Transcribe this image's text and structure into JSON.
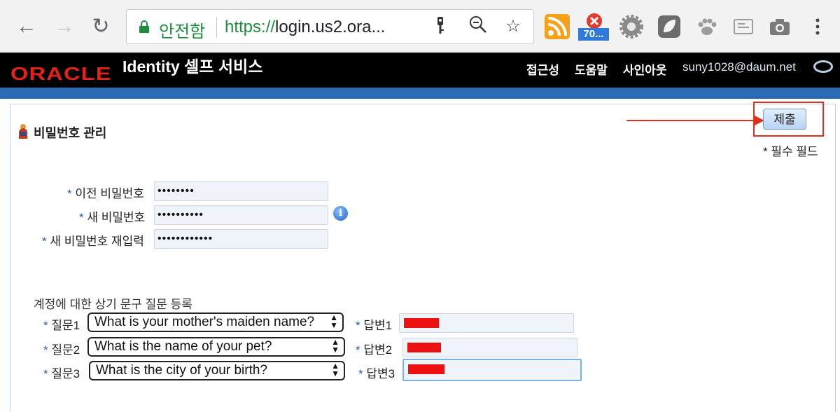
{
  "browser": {
    "secure_label": "안전함",
    "url_scheme": "https://",
    "url_rest": "login.us2.ora...",
    "notification_badge": "70..."
  },
  "header": {
    "logo": "ORACLE",
    "app_title": "Identity 셀프 서비스",
    "links": [
      "접근성",
      "도움말",
      "사인아웃"
    ],
    "user": "suny1028@daum.net"
  },
  "page": {
    "section_title": "비밀번호 관리",
    "submit_label": "제출",
    "required_note": "* 필수 필드"
  },
  "password": {
    "old_label": "이전 비밀번호",
    "old_value": "••••••••",
    "new_label": "새 비밀번호",
    "new_value": "••••••••••",
    "confirm_label": "새 비밀번호 재입력",
    "confirm_value": "••••••••••••",
    "star": "*"
  },
  "challenge": {
    "heading": "계정에 대한 상기 문구 질문 등록",
    "questions": [
      {
        "q_label": "질문1",
        "q_value": "What is your mother's maiden name?",
        "a_label": "답변1"
      },
      {
        "q_label": "질문2",
        "q_value": "What is the name of your pet?",
        "a_label": "답변2"
      },
      {
        "q_label": "질문3",
        "q_value": "What is the city of your birth?",
        "a_label": "답변3"
      }
    ]
  },
  "colors": {
    "oracle_red": "#e2231a",
    "header_bg": "#000000",
    "stripe_blue": "#2a6ab5",
    "annotation_red": "#e03020"
  }
}
